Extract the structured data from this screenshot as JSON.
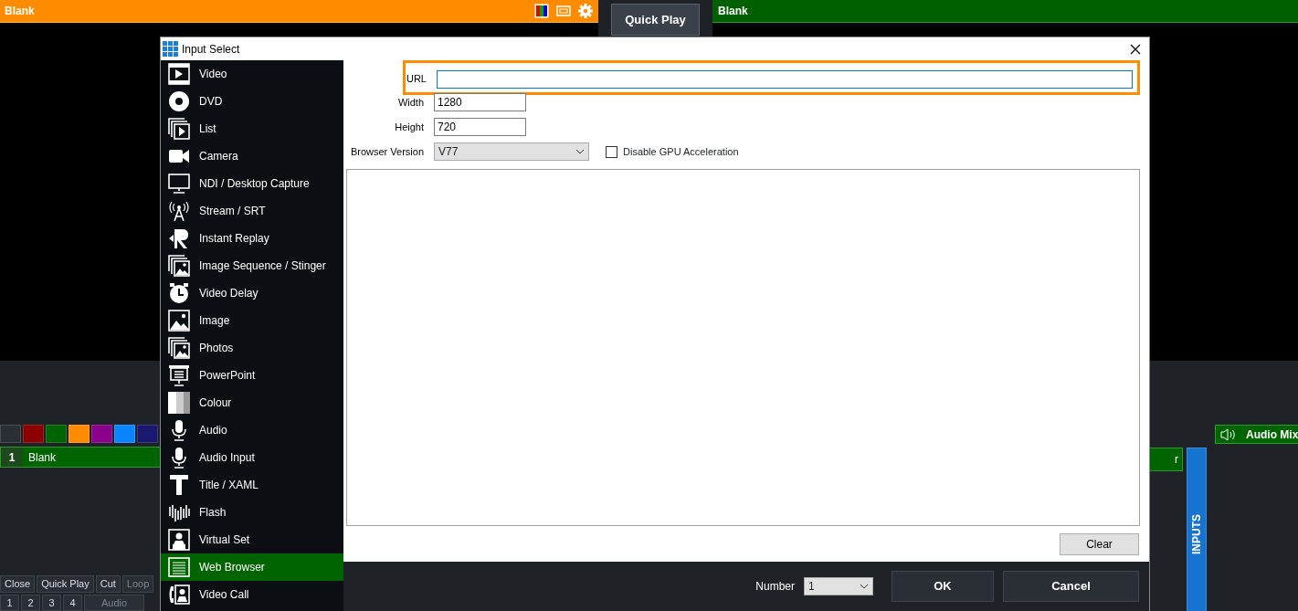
{
  "app": {
    "preview_title": "Blank",
    "quick_play": "Quick Play",
    "output_title": "Blank",
    "swatches": [
      {
        "color": "#2a2f36"
      },
      {
        "color": "#8b0000"
      },
      {
        "color": "#006400"
      },
      {
        "color": "#ff8c00"
      },
      {
        "color": "#8b008b"
      },
      {
        "color": "#0a84ff"
      },
      {
        "color": "#191970"
      }
    ],
    "input_row": {
      "number": "1",
      "title": "Blank"
    },
    "bottom_buttons": [
      {
        "label": "Close",
        "disabled": false
      },
      {
        "label": "Quick Play",
        "disabled": false
      },
      {
        "label": "Cut",
        "disabled": false
      },
      {
        "label": "Loop",
        "disabled": true
      }
    ],
    "number_buttons": [
      "1",
      "2",
      "3",
      "4"
    ],
    "audio_button": {
      "label": "Audio",
      "disabled": true
    },
    "panel_tab": "r",
    "audio_mixer": "Audio Mix",
    "inputs_tab": "INPUTS"
  },
  "dialog": {
    "title": "Input Select",
    "types": [
      {
        "label": "Video",
        "selected": false
      },
      {
        "label": "DVD",
        "selected": false
      },
      {
        "label": "List",
        "selected": false
      },
      {
        "label": "Camera",
        "selected": false
      },
      {
        "label": "NDI / Desktop Capture",
        "selected": false
      },
      {
        "label": "Stream / SRT",
        "selected": false
      },
      {
        "label": "Instant Replay",
        "selected": false
      },
      {
        "label": "Image Sequence / Stinger",
        "selected": false
      },
      {
        "label": "Video Delay",
        "selected": false
      },
      {
        "label": "Image",
        "selected": false
      },
      {
        "label": "Photos",
        "selected": false
      },
      {
        "label": "PowerPoint",
        "selected": false
      },
      {
        "label": "Colour",
        "selected": false
      },
      {
        "label": "Audio",
        "selected": false
      },
      {
        "label": "Audio Input",
        "selected": false
      },
      {
        "label": "Title / XAML",
        "selected": false
      },
      {
        "label": "Flash",
        "selected": false
      },
      {
        "label": "Virtual Set",
        "selected": false
      },
      {
        "label": "Web Browser",
        "selected": true
      },
      {
        "label": "Video Call",
        "selected": false
      }
    ],
    "url": {
      "label": "URL",
      "highlighted": true
    },
    "width": {
      "label": "Width",
      "value": "1280"
    },
    "height": {
      "label": "Height",
      "value": "720"
    },
    "browser_version": {
      "label": "Browser Version",
      "value": "V77"
    },
    "disable_gpu": {
      "label": "Disable GPU Acceleration",
      "checked": false
    },
    "clear": "Clear",
    "number": {
      "label": "Number",
      "value": "1"
    },
    "ok": "OK",
    "cancel": "Cancel"
  }
}
